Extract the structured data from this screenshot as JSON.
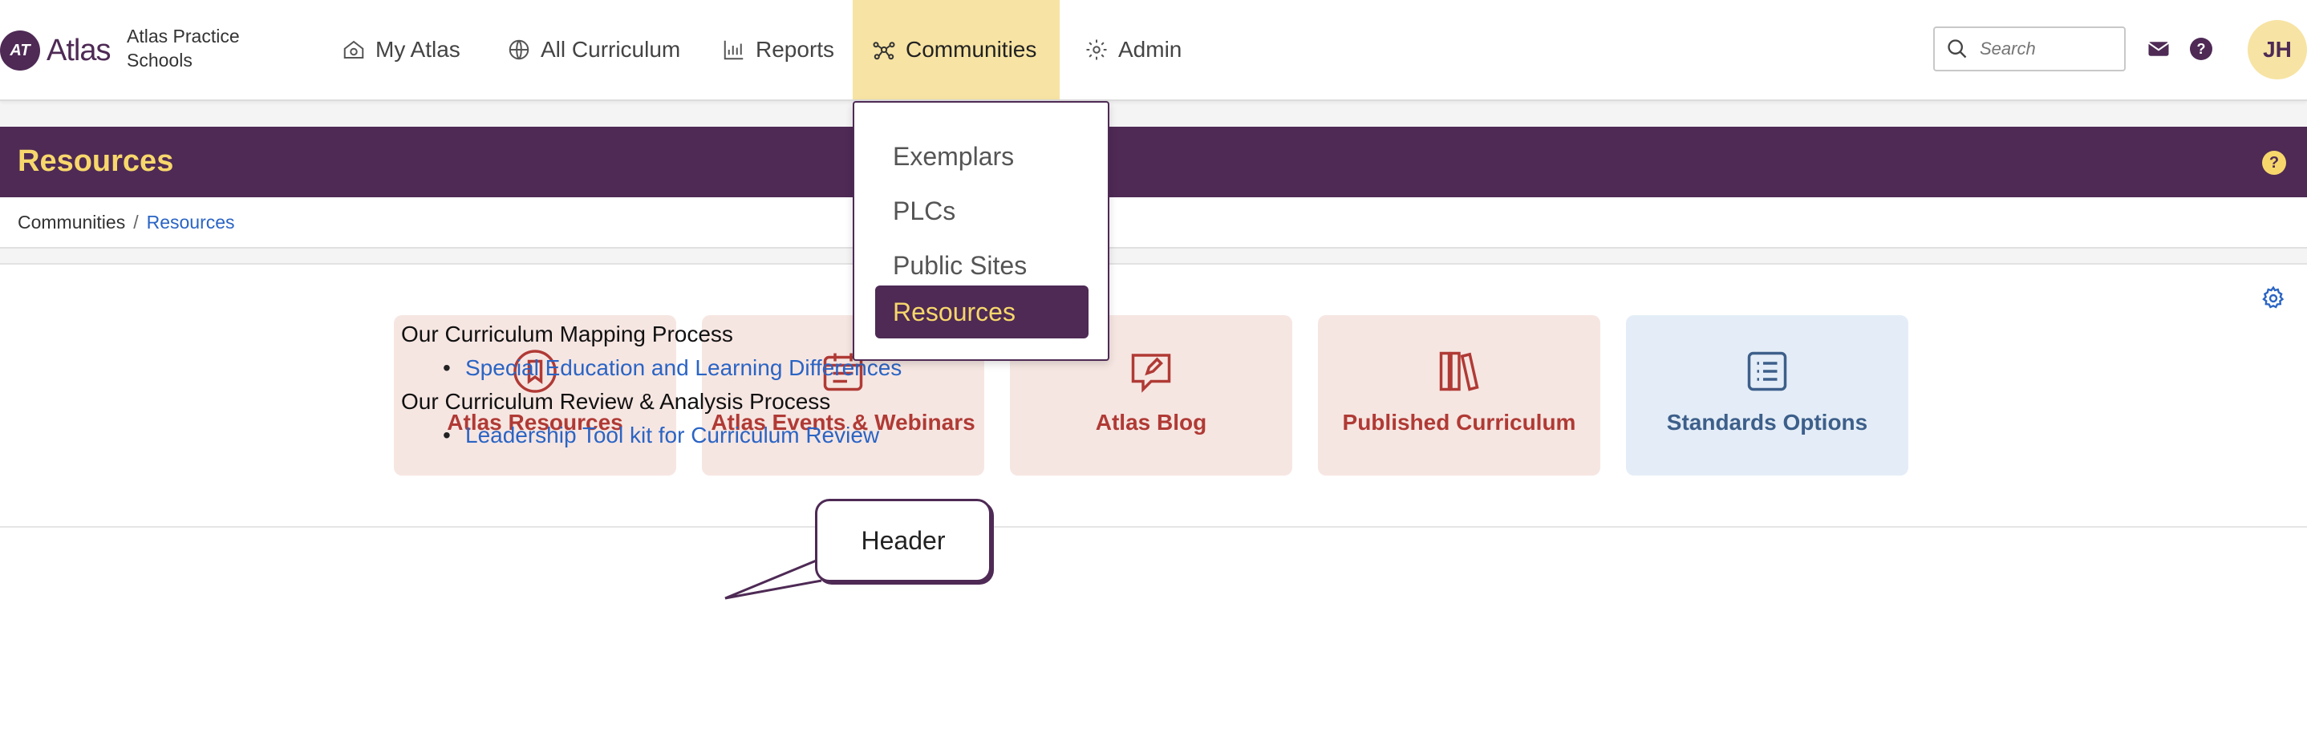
{
  "topnav": {
    "logo_badge": "AT",
    "logo_text": "Atlas",
    "school_line1": "Atlas Practice",
    "school_line2": "Schools",
    "items": [
      {
        "label": "My Atlas",
        "icon": "home-gear-icon"
      },
      {
        "label": "All Curriculum",
        "icon": "globe-icon"
      },
      {
        "label": "Reports",
        "icon": "bar-chart-icon"
      },
      {
        "label": "Communities",
        "icon": "network-icon",
        "active": true
      },
      {
        "label": "Admin",
        "icon": "gear-icon"
      }
    ],
    "search_placeholder": "Search",
    "help": "?",
    "avatar": "JH"
  },
  "dropdown": {
    "items": [
      "Exemplars",
      "PLCs",
      "Public Sites",
      "Resources"
    ],
    "active": "Resources"
  },
  "page": {
    "title": "Resources",
    "help": "?",
    "breadcrumb": {
      "parent": "Communities",
      "separator": "/",
      "current": "Resources"
    }
  },
  "tiles": [
    {
      "label": "Atlas Resources",
      "icon": "bookmark-icon"
    },
    {
      "label": "Atlas Events & Webinars",
      "icon": "calendar-icon"
    },
    {
      "label": "Atlas Blog",
      "icon": "chat-pencil-icon"
    },
    {
      "label": "Published Curriculum",
      "icon": "books-icon"
    },
    {
      "label": "Standards Options",
      "icon": "list-icon"
    }
  ],
  "content": {
    "section1_heading": "Our Curriculum Mapping Process",
    "section1_link": "Special Education and Learning Differences",
    "section2_heading": "Our Curriculum Review & Analysis Process",
    "section2_link": "Leadership Tool kit for Curriculum Review"
  },
  "callout": {
    "text": "Header"
  },
  "colors": {
    "brand": "#4e2a55",
    "accent": "#f7d76b",
    "active_nav": "#f7e3a3",
    "link": "#2a64c4",
    "tile": "#f6e6e2",
    "tile_text": "#b03a35"
  }
}
